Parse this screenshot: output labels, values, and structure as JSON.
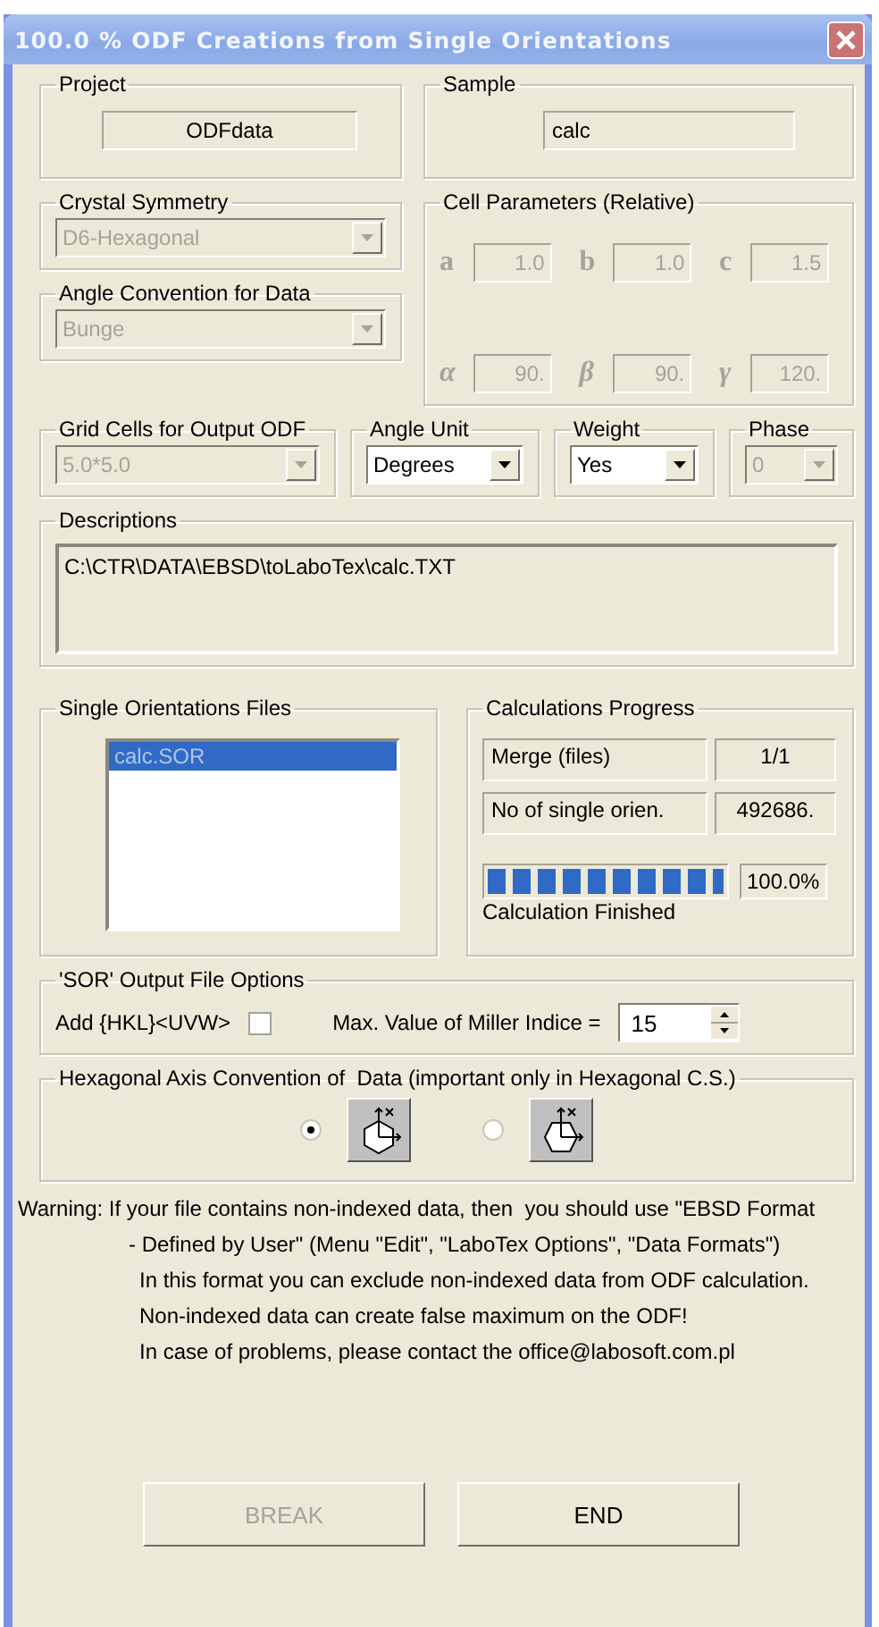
{
  "window": {
    "title": "100.0 % ODF Creations from Single Orientations"
  },
  "project": {
    "label": "Project",
    "value": "ODFdata"
  },
  "sample": {
    "label": "Sample",
    "value": "calc"
  },
  "crystal_symmetry": {
    "label": "Crystal Symmetry",
    "value": "D6-Hexagonal",
    "disabled": true
  },
  "angle_convention": {
    "label": "Angle Convention for Data",
    "value": "Bunge",
    "disabled": true
  },
  "cell_parameters": {
    "label": "Cell Parameters (Relative)",
    "disabled": true,
    "params": [
      {
        "symbol": "a",
        "value": "1.0",
        "kind": "latin"
      },
      {
        "symbol": "b",
        "value": "1.0",
        "kind": "latin"
      },
      {
        "symbol": "c",
        "value": "1.5",
        "kind": "latin"
      },
      {
        "symbol": "α",
        "value": "90.",
        "kind": "greek"
      },
      {
        "symbol": "β",
        "value": "90.",
        "kind": "greek"
      },
      {
        "symbol": "γ",
        "value": "120.",
        "kind": "greek"
      }
    ]
  },
  "selectors": [
    {
      "label": "Grid Cells for Output ODF",
      "value": "5.0*5.0",
      "disabled": true
    },
    {
      "label": "Angle Unit",
      "value": "Degrees",
      "disabled": false
    },
    {
      "label": "Weight",
      "value": "Yes",
      "disabled": false
    },
    {
      "label": "Phase",
      "value": "0",
      "disabled": true
    }
  ],
  "descriptions": {
    "label": "Descriptions",
    "value": "C:\\CTR\\DATA\\EBSD\\toLaboTex\\calc.TXT"
  },
  "files": {
    "label": "Single Orientations Files",
    "items": [
      {
        "name": "calc.SOR",
        "selected": true
      }
    ]
  },
  "progress": {
    "label": "Calculations Progress",
    "rows": [
      {
        "label": "Merge (files)",
        "value": "1/1"
      },
      {
        "label": "No of single orien.",
        "value": "492686."
      }
    ],
    "level": 1,
    "percent": "100.0%",
    "status": "Calculation Finished"
  },
  "sor_options": {
    "label": "'SOR' Output File Options",
    "add_label": "Add {HKL}<UVW>",
    "add_checked": false,
    "max_label": "Max. Value of Miller Indice =",
    "max_value": "15"
  },
  "hex_axis": {
    "label": "Hexagonal Axis Convention of  Data (important only in Hexagonal C.S.)",
    "options": [
      {
        "kind": "pointy",
        "selected": true
      },
      {
        "kind": "flat",
        "selected": false
      }
    ]
  },
  "warning": [
    {
      "kind": "lead",
      "text": "Warning: If your file contains non-indexed data, then  you should use \"EBSD Format"
    },
    {
      "kind": "continued",
      "text": "- Defined by User\" (Menu \"Edit\", \"LaboTex Options\", \"Data Formats\")"
    },
    {
      "kind": "note",
      "text": "In this format you can exclude non-indexed data from ODF calculation."
    },
    {
      "kind": "note",
      "text": "Non-indexed data can create false maximum on the ODF!"
    },
    {
      "kind": "note",
      "text": "In case of problems, please contact the office@labosoft.com.pl"
    }
  ],
  "buttons": [
    {
      "label": "BREAK",
      "disabled": true
    },
    {
      "label": "END",
      "disabled": false
    }
  ]
}
